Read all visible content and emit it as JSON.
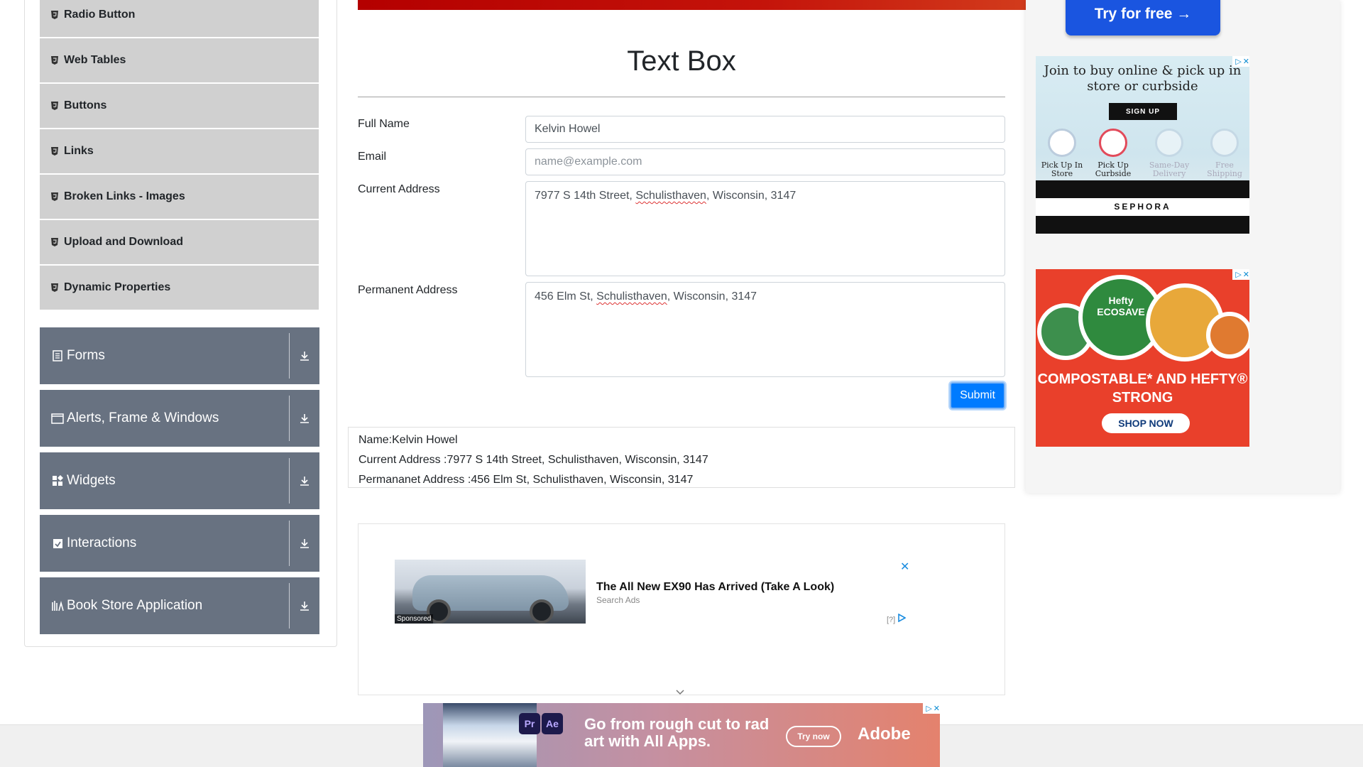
{
  "sidebar": {
    "elements_subitems": [
      {
        "label": "Radio Button"
      },
      {
        "label": "Web Tables"
      },
      {
        "label": "Buttons"
      },
      {
        "label": "Links"
      },
      {
        "label": "Broken Links - Images"
      },
      {
        "label": "Upload and Download"
      },
      {
        "label": "Dynamic Properties"
      }
    ],
    "groups": [
      {
        "label": "Forms",
        "icon": "form-icon"
      },
      {
        "label": "Alerts, Frame & Windows",
        "icon": "window-icon"
      },
      {
        "label": "Widgets",
        "icon": "widgets-icon"
      },
      {
        "label": "Interactions",
        "icon": "interactions-icon"
      },
      {
        "label": "Book Store Application",
        "icon": "book-icon"
      }
    ]
  },
  "main": {
    "title": "Text Box",
    "form": {
      "full_name_label": "Full Name",
      "full_name_value": "Kelvin Howel",
      "email_label": "Email",
      "email_placeholder": "name@example.com",
      "current_address_label": "Current Address",
      "current_address_parts": [
        "7977 S 14th Street, ",
        "Schulisthaven",
        ", Wisconsin, 3147"
      ],
      "permanent_address_label": "Permanent Address",
      "permanent_address_parts": [
        "456 Elm St, ",
        "Schulisthaven",
        ", Wisconsin, 3147"
      ],
      "submit_label": "Submit"
    },
    "output": {
      "name": "Name:Kelvin Howel",
      "current_address": "Current Address :7977 S 14th Street, Schulisthaven, Wisconsin, 3147",
      "permanent_address": "Permananet Address :456 Elm St, Schulisthaven, Wisconsin, 3147"
    }
  },
  "inline_ad": {
    "headline": "The All New EX90 Has Arrived (Take A Look)",
    "source": "Search Ads",
    "sponsored": "Sponsored",
    "close": "✕",
    "info": "[?]"
  },
  "right_ads": {
    "top_button": "Try for free →",
    "sephora": {
      "text": "Join to buy online & pick up in store or curbside",
      "signup": "SIGN UP",
      "options": [
        "Pick Up In Store",
        "Pick Up Curbside",
        "Same-Day Delivery",
        "Free Shipping"
      ],
      "brand": "SEPHORA"
    },
    "hefty": {
      "plate_label": "Hefty ECOSAVE",
      "headline": "COMPOSTABLE* AND HEFTY® STRONG",
      "cta": "SHOP NOW"
    }
  },
  "bottom_ad": {
    "app1": "Pr",
    "app2": "Ae",
    "message": "Go from rough cut to rad art with All Apps.",
    "cta": "Try now",
    "brand": "Adobe"
  },
  "colors": {
    "sidebar_group_bg": "#687281",
    "sidebar_subitem_bg": "#d0d0d0",
    "submit_bg": "#007bff",
    "topbar_red": "#c4130a"
  }
}
